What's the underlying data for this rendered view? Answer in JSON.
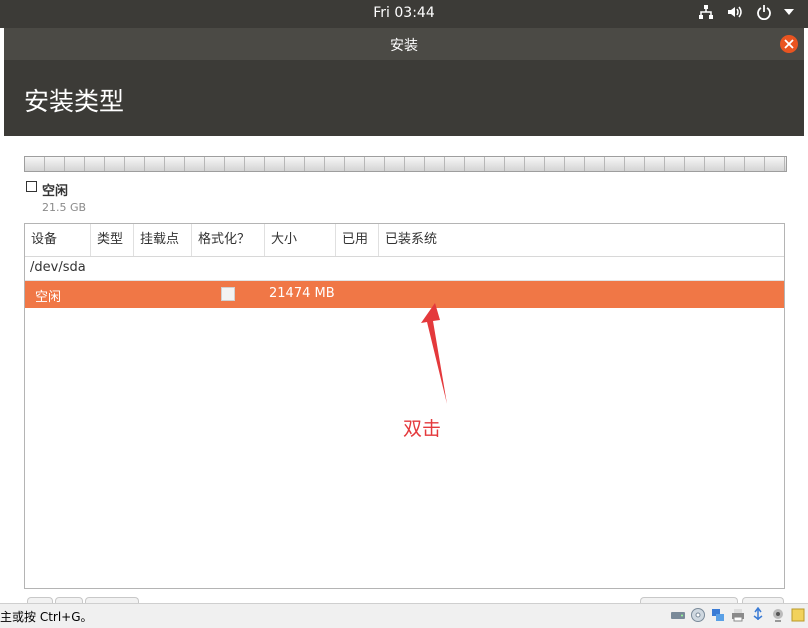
{
  "topbar": {
    "clock": "Fri 03:44",
    "icons": [
      "network-icon",
      "volume-icon",
      "power-icon",
      "chevron-down-icon"
    ]
  },
  "window": {
    "title": "安装",
    "heading": "安装类型"
  },
  "disk": {
    "legend_label": "空闲",
    "legend_size": "21.5 GB"
  },
  "table": {
    "columns": [
      "设备",
      "类型",
      "挂载点",
      "格式化？",
      "大小",
      "已用",
      "已装系统"
    ],
    "device": "/dev/sda",
    "selected_row": {
      "device": "空闲",
      "type": "",
      "mount": "",
      "format_checked": false,
      "size": "21474 MB",
      "used": "",
      "system": ""
    }
  },
  "annotation": {
    "text": "双击",
    "color": "#e4393c"
  },
  "statusbar": {
    "hint": "主或按 Ctrl+G。",
    "icons": [
      "hdd-icon",
      "cd-icon",
      "network-adapter-icon",
      "printer-icon",
      "usb-icon",
      "webcam-icon",
      "notes-icon"
    ]
  },
  "colors": {
    "selection": "#f07746",
    "close_button": "#e95420",
    "header_bg": "#3c3b37"
  }
}
